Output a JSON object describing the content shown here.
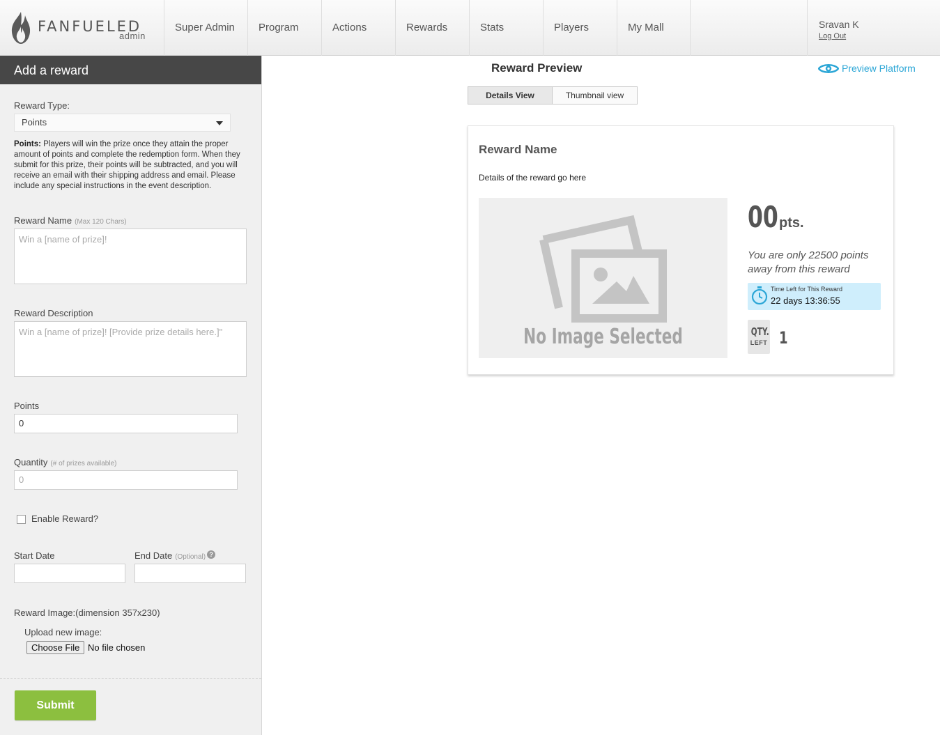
{
  "brand": {
    "name": "FANFUELED",
    "sub": "admin"
  },
  "nav": {
    "items": [
      {
        "label": "Super Admin"
      },
      {
        "label": "Program"
      },
      {
        "label": "Actions"
      },
      {
        "label": "Rewards"
      },
      {
        "label": "Stats"
      },
      {
        "label": "Players"
      },
      {
        "label": "My Mall"
      }
    ]
  },
  "user": {
    "name": "Sravan K",
    "logout": "Log Out"
  },
  "sidebar": {
    "header": "Add a reward",
    "reward_type_label": "Reward Type:",
    "reward_type_value": "Points",
    "description_bold": "Points:",
    "description_text": " Players will win the prize once they attain the proper amount of points and complete the redemption form. When they submit for this prize, their points will be subtracted, and you will receive an email with their shipping address and email. Please include any special instructions in the event description.",
    "reward_name_label": "Reward Name",
    "reward_name_hint": "(Max 120 Chars)",
    "reward_name_placeholder": "Win a [name of prize]!",
    "reward_desc_label": "Reward Description",
    "reward_desc_placeholder": "Win a [name of prize]! [Provide prize details here.]\"",
    "points_label": "Points",
    "points_value": "0",
    "quantity_label": "Quantity",
    "quantity_hint": "(# of prizes available)",
    "quantity_placeholder": "0",
    "enable_label": "Enable Reward?",
    "start_date_label": "Start Date",
    "end_date_label": "End Date",
    "end_date_hint": "(Optional)",
    "image_label": "Reward Image:(dimension 357x230)",
    "upload_label": "Upload new image:",
    "choose_file": "Choose File",
    "no_file": "No file chosen",
    "submit": "Submit"
  },
  "preview": {
    "title": "Reward Preview",
    "platform_link": "Preview Platform",
    "tabs": [
      {
        "label": "Details View"
      },
      {
        "label": "Thumbnail view"
      }
    ],
    "card": {
      "reward_name": "Reward Name",
      "details": "Details of the reward go here",
      "no_image": "No Image Selected",
      "points": "00",
      "points_unit": "pts.",
      "away": "You are only 22500 points away from this reward",
      "time_left_label": "Time Left for This Reward",
      "time_left_value": "22 days 13:36:55",
      "qty_label": "QTY.",
      "qty_sub": "LEFT",
      "qty_value": "1"
    }
  },
  "colors": {
    "accent": "#2ba6d6",
    "submit": "#8cbf3f",
    "header": "#474747",
    "timer_bg": "#cfeefc"
  }
}
